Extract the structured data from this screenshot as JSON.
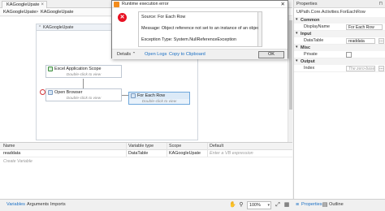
{
  "document": {
    "tab_label": "KAGoogleUpate",
    "tab_close": "×",
    "breadcrumb": [
      "KAGoogleUpate",
      "KAGoogleUpate"
    ],
    "breadcrumb_sep": ">"
  },
  "designer": {
    "sequence_title": "KAGoogleUpate",
    "sequence_chevron": "⌃",
    "activities": [
      {
        "title": "Excel Application Scope",
        "hint": "Double-click to view"
      },
      {
        "title": "Open Browser",
        "hint": "Double-click to view"
      },
      {
        "title": "For Each Row",
        "hint": "Double-click to view"
      }
    ]
  },
  "dialog": {
    "title": "Runtime execution error",
    "close_glyph": "✕",
    "error_glyph": "✕",
    "lines": [
      "Source: For Each Row",
      "Message: Object reference not set to an instance of an object.",
      "Exception Type: System.NullReferenceException"
    ],
    "details_label": "Details ⌃",
    "open_logs": "Open Logs",
    "copy_clipboard": "Copy to Clipboard",
    "ok_label": "OK"
  },
  "variables": {
    "columns": [
      "Name",
      "Variable type",
      "Scope",
      "Default"
    ],
    "rows": [
      {
        "name": "readdata",
        "type": "DataTable",
        "scope": "KAGoogleUpate",
        "default": "Enter a VB expression"
      }
    ],
    "create_label": "Create Variable"
  },
  "bottom_bar": {
    "tabs": [
      "Variables",
      "Arguments",
      "Imports"
    ],
    "zoom": "100%",
    "zoom_caret": "▾",
    "panel_tabs": [
      "Properties",
      "Outline"
    ]
  },
  "properties": {
    "title": "Properties",
    "pin": "⊓",
    "type_name": "UiPath.Core.Activities.ForEachRow",
    "categories": [
      {
        "name": "Common",
        "rows": [
          {
            "label": "DisplayName",
            "value": "For Each Row"
          }
        ]
      },
      {
        "name": "Input",
        "rows": [
          {
            "label": "DataTable",
            "value": "readdata"
          }
        ]
      },
      {
        "name": "Misc",
        "rows": [
          {
            "label": "Private",
            "value": ""
          }
        ]
      },
      {
        "name": "Output",
        "rows": [
          {
            "label": "Index",
            "value": "The zero-based"
          }
        ]
      }
    ],
    "ellipsis": "…"
  },
  "colors": {
    "error_red": "#e81123",
    "link_blue": "#1a6fc4",
    "selection_blue": "#6fa8dc"
  }
}
